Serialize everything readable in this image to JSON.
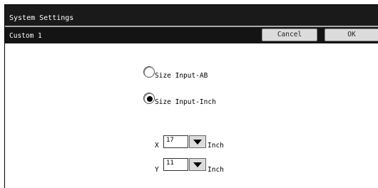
{
  "window": {
    "title": "System Settings"
  },
  "header": {
    "label": "Custom 1",
    "cancel_label": "Cancel",
    "ok_label": "OK"
  },
  "size_input": {
    "options": [
      {
        "label": "Size Input-AB",
        "selected": false
      },
      {
        "label": "Size Input-Inch",
        "selected": true
      }
    ]
  },
  "dimensions": {
    "x": {
      "axis": "X",
      "value": "17",
      "unit": "Inch"
    },
    "y": {
      "axis": "Y",
      "value": "11",
      "unit": "Inch"
    }
  }
}
